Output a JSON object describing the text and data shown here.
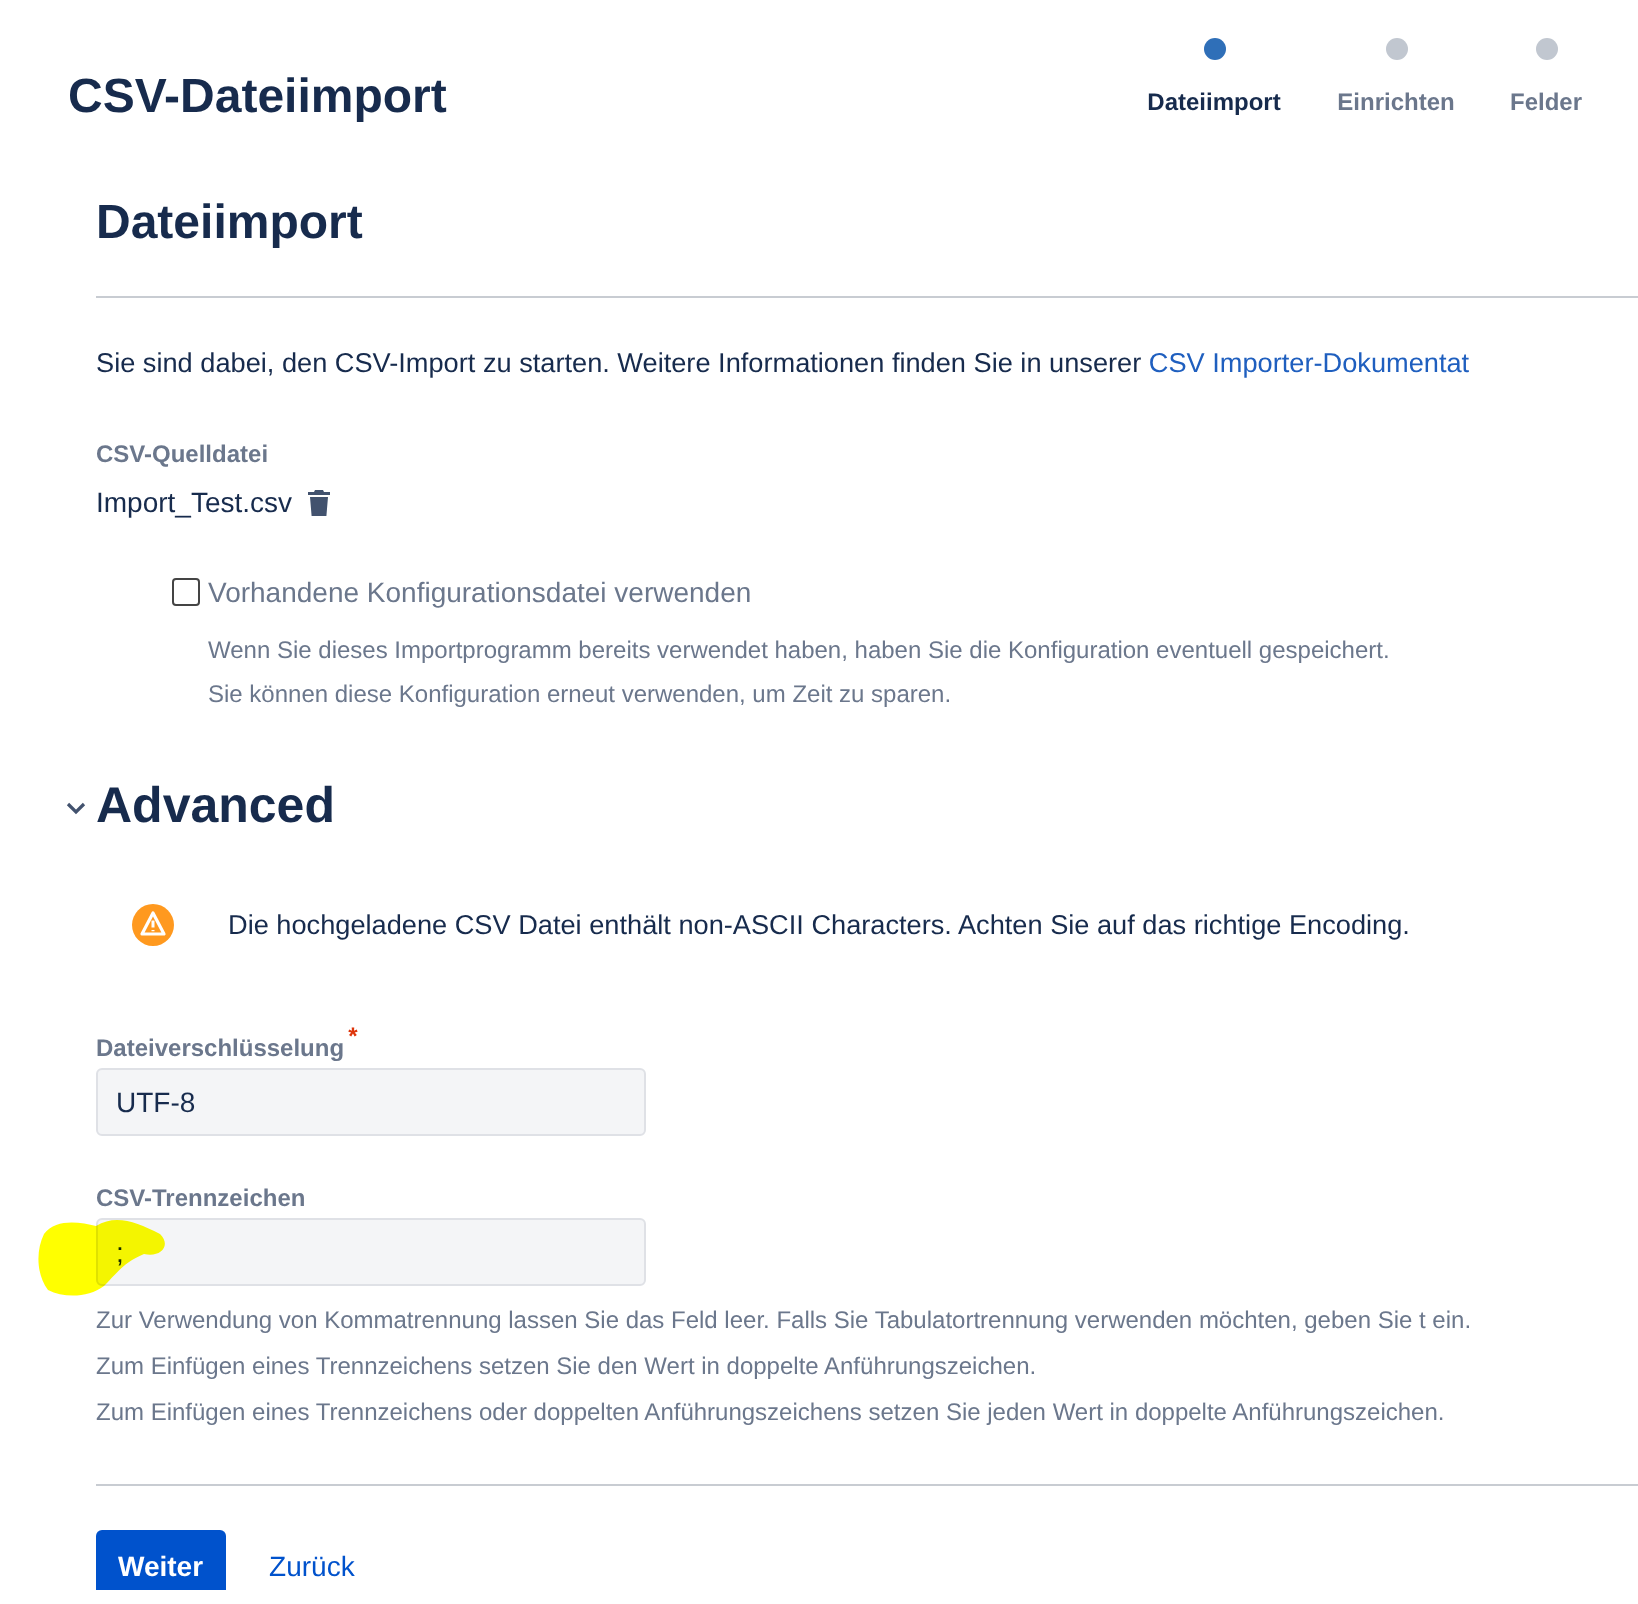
{
  "title": "CSV-Dateiimport",
  "steps": [
    {
      "label": "Dateiimport",
      "selected": true
    },
    {
      "label": "Einrichten",
      "selected": false
    },
    {
      "label": "Felder",
      "selected": false
    }
  ],
  "section_title": "Dateiimport",
  "intro": {
    "text": "Sie sind dabei, den CSV-Import zu starten. Weitere Informationen finden Sie in unserer ",
    "link": "CSV Importer-Dokumentat"
  },
  "source_file": {
    "label": "CSV-Quelldatei",
    "file_name": "Import_Test.csv"
  },
  "config_option": {
    "label": "Vorhandene Konfigurationsdatei verwenden",
    "checked": false,
    "help": [
      "Wenn Sie dieses Importprogramm bereits verwendet haben, haben Sie die Konfiguration eventuell gespeichert.",
      "Sie können diese Konfiguration erneut verwenden, um Zeit zu sparen."
    ]
  },
  "advanced": {
    "title": "Advanced",
    "expanded": true,
    "warning": "Die hochgeladene CSV Datei enthält non-ASCII Characters. Achten Sie auf das richtige Encoding.",
    "fields": [
      {
        "label": "Dateiverschlüsselung",
        "required_mark": "*",
        "value": "UTF-8"
      },
      {
        "label": "CSV-Trennzeichen",
        "value": ";",
        "help": [
          "Zur Verwendung von Kommatrennung lassen Sie das Feld leer. Falls Sie Tabulatortrennung verwenden möchten, geben Sie t ein.",
          "Zum Einfügen eines Trennzeichens setzen Sie den Wert in doppelte Anführungszeichen.",
          "Zum Einfügen eines Trennzeichens oder doppelten Anführungszeichens setzen Sie jeden Wert in doppelte Anführungszeichen."
        ]
      }
    ]
  },
  "buttons": [
    {
      "label": "Weiter",
      "kind": "primary"
    },
    {
      "label": "Zurück",
      "kind": "link"
    }
  ]
}
